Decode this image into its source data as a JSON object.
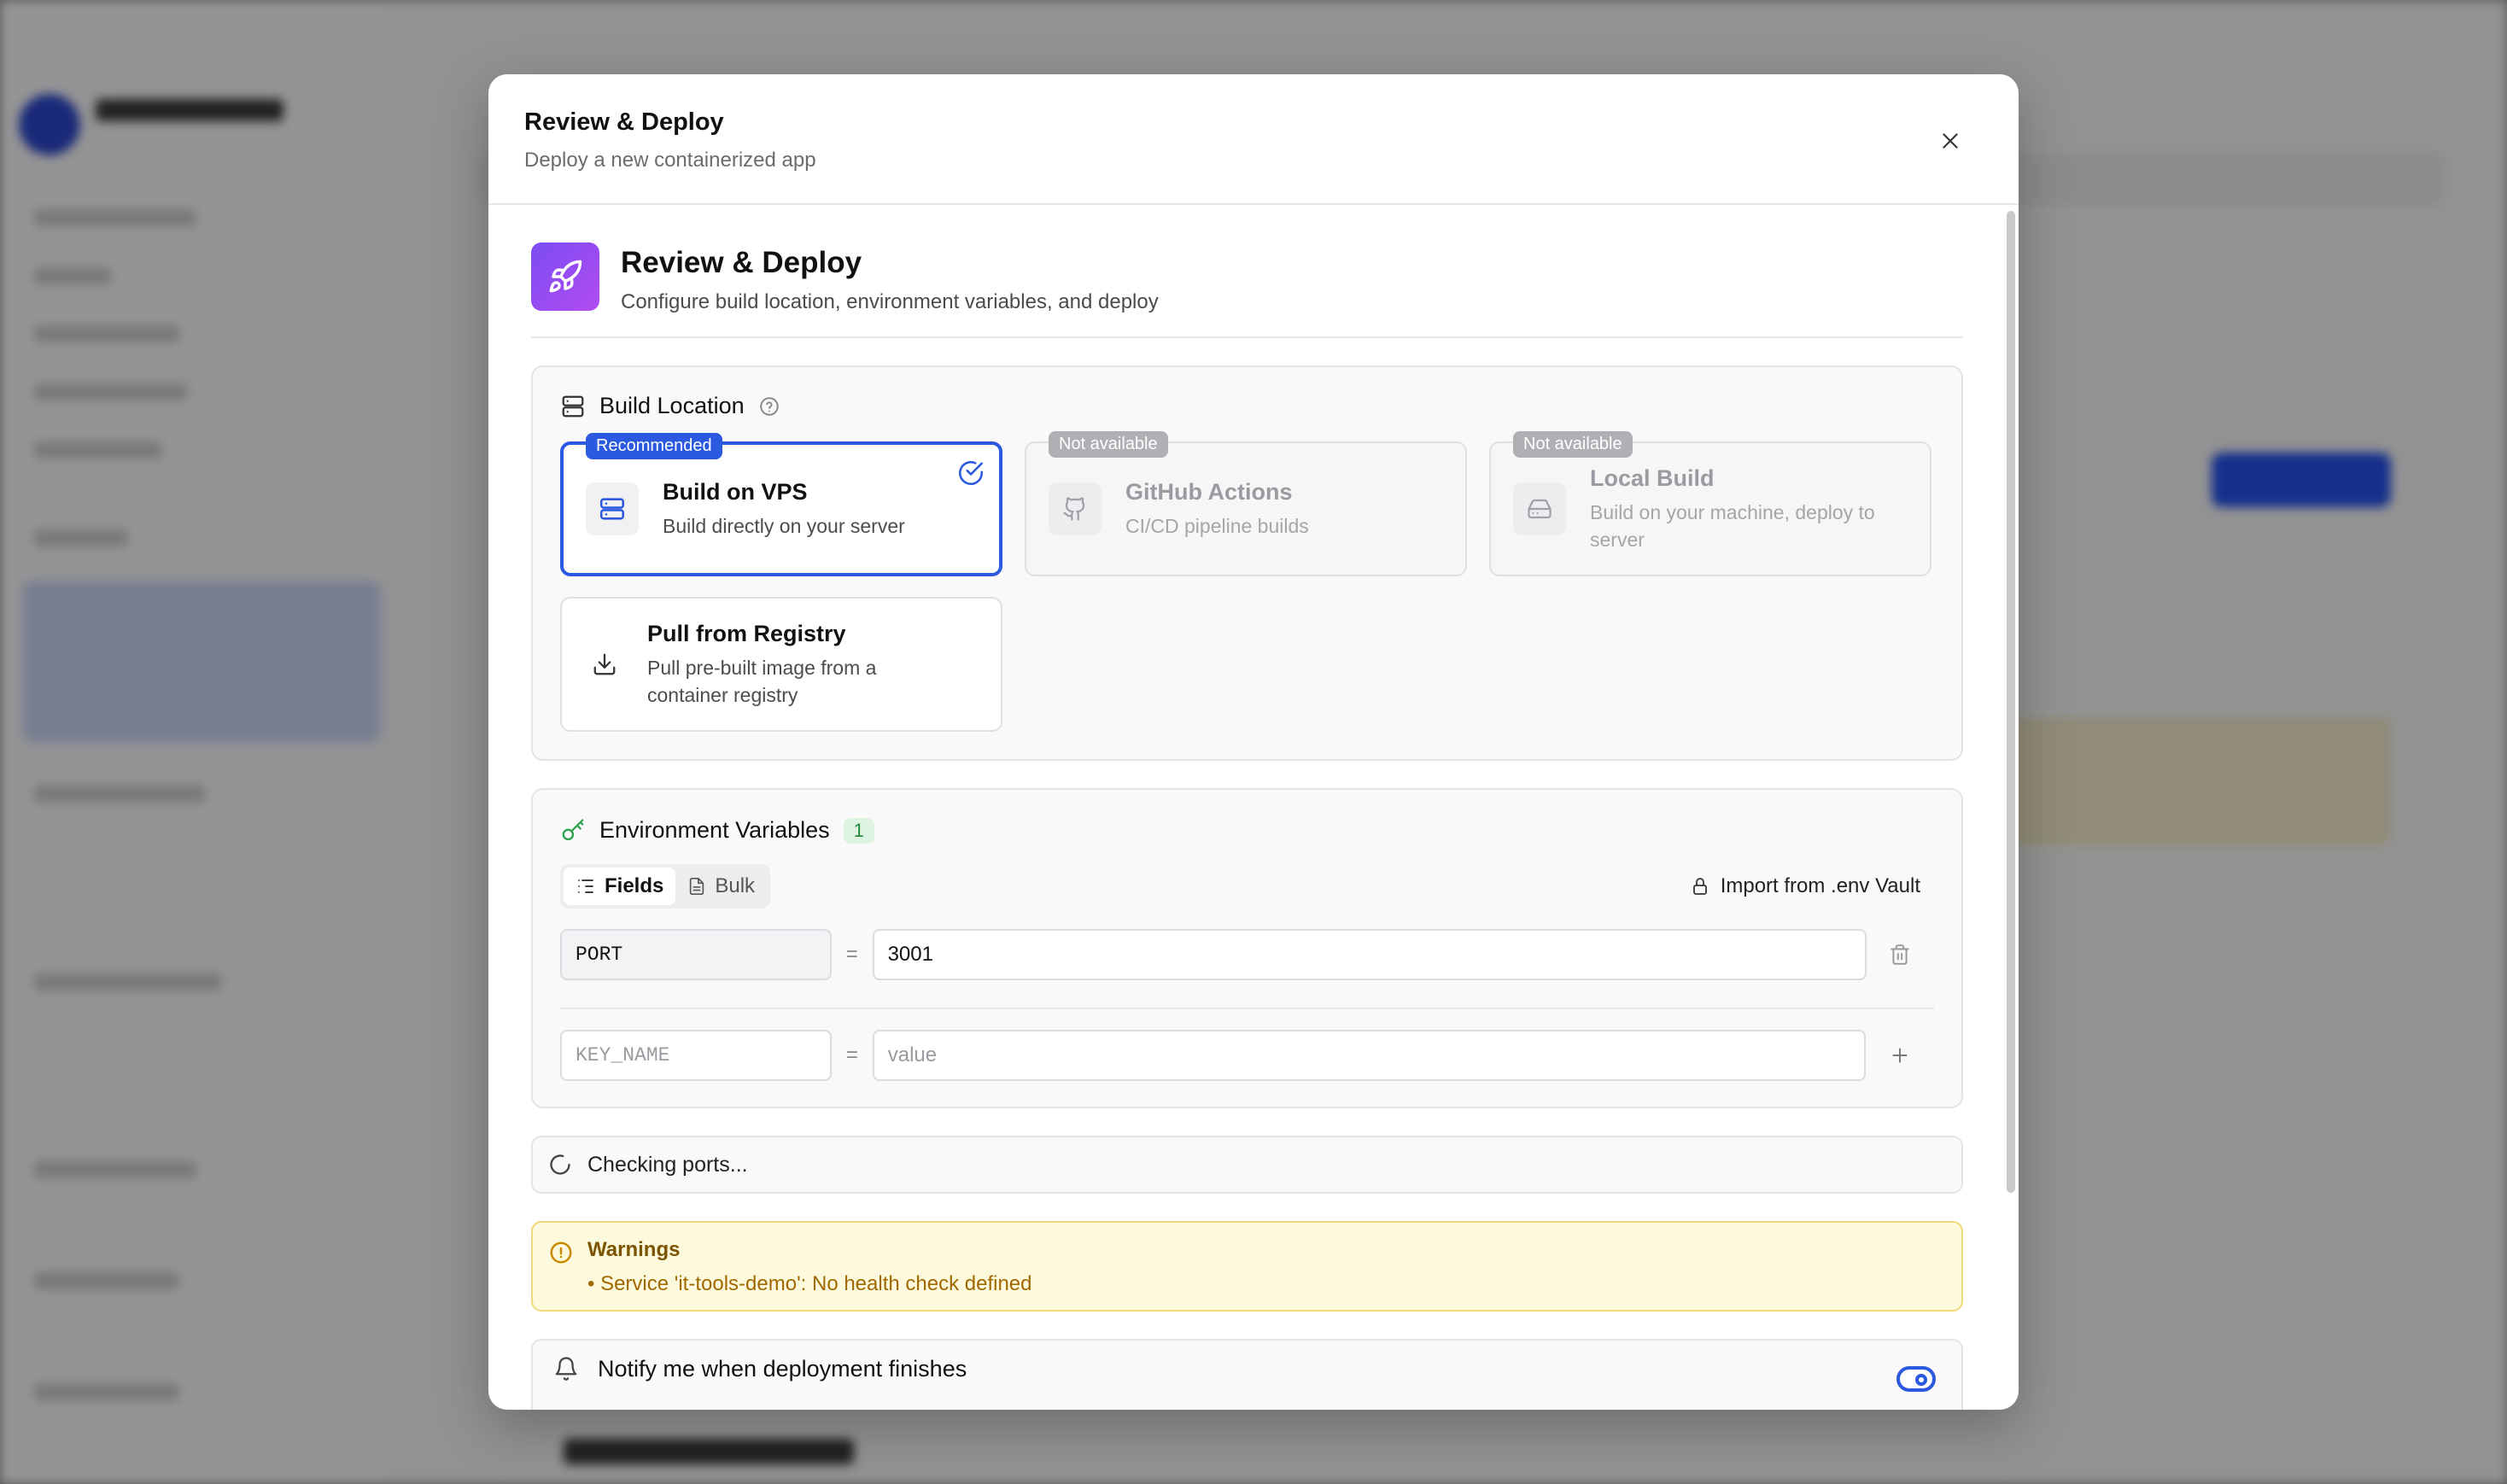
{
  "modal": {
    "title": "Review & Deploy",
    "subtitle": "Deploy a new containerized app"
  },
  "step": {
    "title": "Review & Deploy",
    "description": "Configure build location, environment variables, and deploy"
  },
  "build_location": {
    "heading": "Build Location",
    "options": [
      {
        "title": "Build on VPS",
        "description": "Build directly on your server",
        "badge": "Recommended",
        "selected": true,
        "icon": "server-icon"
      },
      {
        "title": "GitHub Actions",
        "description": "CI/CD pipeline builds",
        "badge": "Not available",
        "disabled": true,
        "icon": "github-icon"
      },
      {
        "title": "Local Build",
        "description": "Build on your machine, deploy to server",
        "badge": "Not available",
        "disabled": true,
        "icon": "hard-drive-icon"
      },
      {
        "title": "Pull from Registry",
        "description": "Pull pre-built image from a container registry",
        "icon": "download-icon"
      }
    ]
  },
  "env": {
    "heading": "Environment Variables",
    "count": "1",
    "tabs": {
      "fields": "Fields",
      "bulk": "Bulk"
    },
    "import_label": "Import from .env Vault",
    "rows": [
      {
        "key": "PORT",
        "value": "3001"
      }
    ],
    "new_row": {
      "key_placeholder": "KEY_NAME",
      "value_placeholder": "value"
    },
    "equals": "="
  },
  "ports": {
    "status": "Checking ports..."
  },
  "warnings": {
    "title": "Warnings",
    "items": [
      "• Service 'it-tools-demo': No health check defined"
    ]
  },
  "notify": {
    "label": "Notify me when deployment finishes",
    "enabled": true
  },
  "colors": {
    "accent": "#2b5ae0",
    "warning_bg": "#fdf9dc",
    "success": "#1f8a3a"
  }
}
